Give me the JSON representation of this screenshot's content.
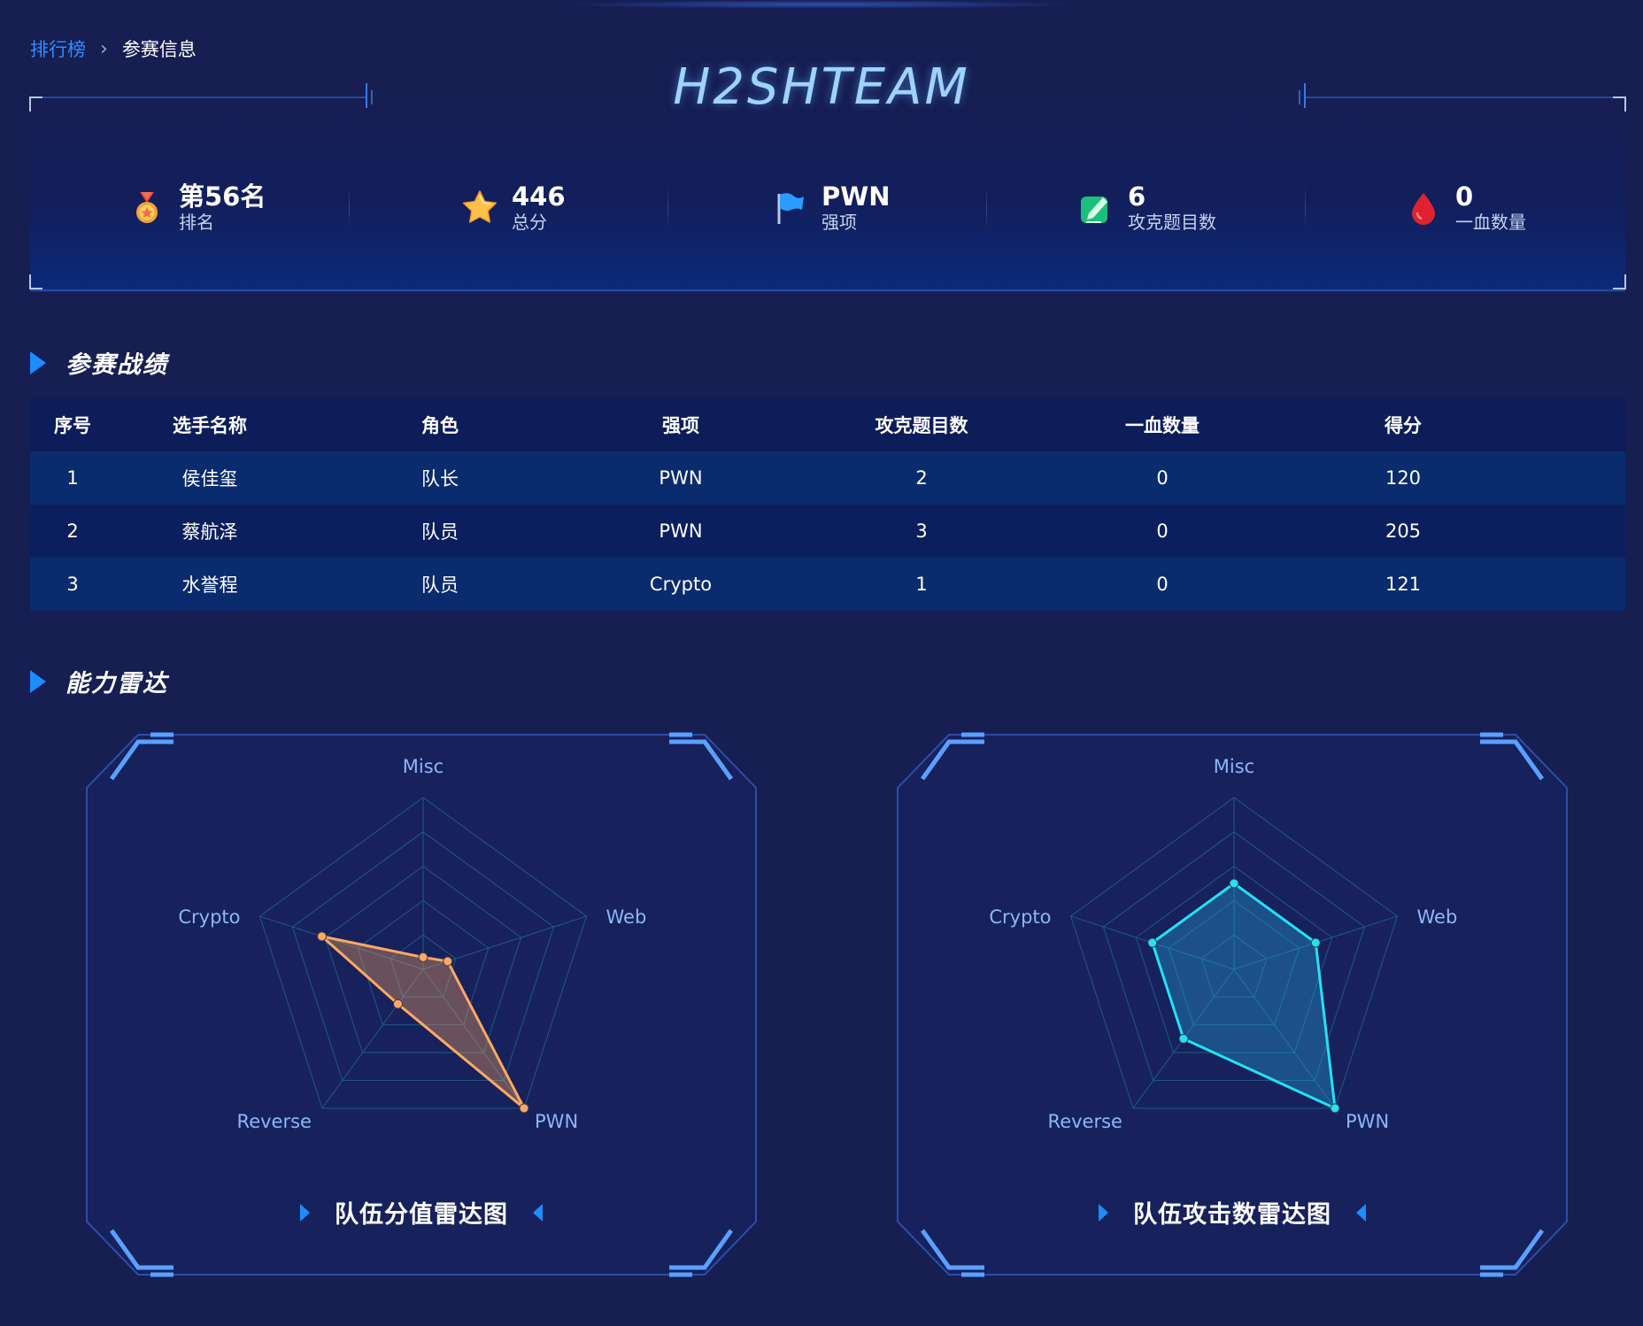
{
  "breadcrumb": {
    "parent": "排行榜",
    "separator": "›",
    "current": "参赛信息"
  },
  "team": {
    "name": "H2SHTEAM"
  },
  "stats": [
    {
      "icon": "medal-icon",
      "value": "第56名",
      "label": "排名"
    },
    {
      "icon": "star-icon",
      "value": "446",
      "label": "总分"
    },
    {
      "icon": "flag-icon",
      "value": "PWN",
      "label": "强项"
    },
    {
      "icon": "edit-icon",
      "value": "6",
      "label": "攻克题目数"
    },
    {
      "icon": "blood-drop-icon",
      "value": "0",
      "label": "一血数量"
    }
  ],
  "sections": {
    "record_title": "参赛战绩",
    "radar_title": "能力雷达"
  },
  "table": {
    "headers": [
      "序号",
      "选手名称",
      "角色",
      "强项",
      "攻克题目数",
      "一血数量",
      "得分"
    ],
    "rows": [
      [
        "1",
        "侯佳玺",
        "队长",
        "PWN",
        "2",
        "0",
        "120"
      ],
      [
        "2",
        "蔡航泽",
        "队员",
        "PWN",
        "3",
        "0",
        "205"
      ],
      [
        "3",
        "水誉程",
        "队员",
        "Crypto",
        "1",
        "0",
        "121"
      ]
    ]
  },
  "chart_data": [
    {
      "type": "radar",
      "title": "队伍分值雷达图",
      "axes": [
        "Misc",
        "Web",
        "PWN",
        "Reverse",
        "Crypto"
      ],
      "max": 1,
      "series": [
        {
          "values": [
            0.07,
            0.15,
            1.0,
            0.25,
            0.62
          ]
        }
      ],
      "colors": {
        "line": "#ffa95e",
        "fill": "rgba(255,169,94,0.35)"
      }
    },
    {
      "type": "radar",
      "title": "队伍攻击数雷达图",
      "axes": [
        "Misc",
        "Web",
        "PWN",
        "Reverse",
        "Crypto"
      ],
      "max": 1,
      "series": [
        {
          "values": [
            0.5,
            0.5,
            1.0,
            0.5,
            0.5
          ]
        }
      ],
      "colors": {
        "line": "#22e3f0",
        "fill": "rgba(34,170,220,0.35)"
      }
    }
  ],
  "colors": {
    "background": "#161e52",
    "accent": "#1c8cff",
    "header_row": "#0c1d5a",
    "row_odd": "#0a2b6d",
    "row_even": "#0b1f5e"
  }
}
